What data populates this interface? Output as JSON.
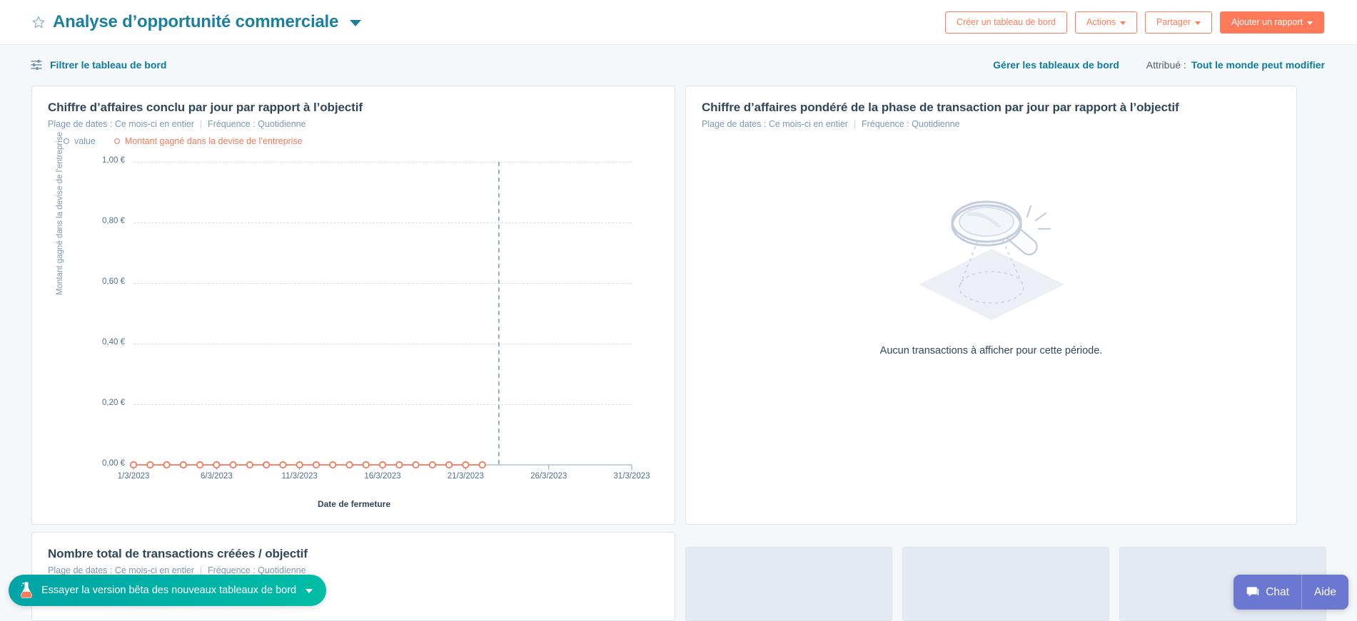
{
  "header": {
    "star_icon": "star-outline-icon",
    "title": "Analyse d’opportunité commerciale",
    "title_caret": "chevron-down-icon",
    "buttons": {
      "create_dashboard": "Créer un tableau de bord",
      "actions": "Actions",
      "share": "Partager",
      "add_report": "Ajouter un rapport"
    },
    "colors": {
      "accent_orange": "#ff7a59",
      "title_teal": "#1b7fa0"
    }
  },
  "filterbar": {
    "filter_icon": "sliders-icon",
    "filter_label": "Filtrer le tableau de bord",
    "manage_label": "Gérer les tableaux de bord",
    "assigned_label": "Attribué :",
    "assigned_value": "Tout le monde peut modifier"
  },
  "cards": {
    "revenue": {
      "title": "Chiffre d’affaires conclu par jour par rapport à l’objectif",
      "date_range": "Plage de dates : Ce mois-ci en entier",
      "frequency": "Fréquence : Quotidienne",
      "legend": [
        {
          "label": "value",
          "color": "#7c98b6"
        },
        {
          "label": "Montant gagné dans la devise de l’entreprise",
          "color": "#f2785c"
        }
      ]
    },
    "weighted": {
      "title": "Chiffre d’affaires pondéré de la phase de transaction par jour par rapport à l’objectif",
      "date_range": "Plage de dates : Ce mois-ci en entier",
      "frequency": "Fréquence : Quotidienne",
      "empty_icon": "magnifier-search-illustration",
      "empty_text": "Aucun transactions à afficher pour cette période."
    },
    "deals": {
      "title": "Nombre total de transactions créées / objectif",
      "date_range": "Plage de dates : Ce mois-ci en entier",
      "frequency": "Fréquence : Quotidienne"
    },
    "skeletons": [
      {
        "name": "skeleton-card-1"
      },
      {
        "name": "skeleton-card-2"
      },
      {
        "name": "skeleton-card-3"
      }
    ]
  },
  "chart_data": {
    "type": "line",
    "title": "Chiffre d’affaires conclu par jour par rapport à l’objectif",
    "xlabel": "Date de fermeture",
    "ylabel": "Montant gagné dans la devise de l’entreprise",
    "ylim": [
      0,
      1
    ],
    "ytick_labels": [
      "0,00 €",
      "0,20 €",
      "0,40 €",
      "0,60 €",
      "0,80 €",
      "1,00 €"
    ],
    "ytick_values": [
      0,
      0.2,
      0.4,
      0.6,
      0.8,
      1.0
    ],
    "xtick_labels": [
      "1/3/2023",
      "6/3/2023",
      "11/3/2023",
      "16/3/2023",
      "21/3/2023",
      "26/3/2023",
      "31/3/2023"
    ],
    "xtick_values": [
      1,
      6,
      11,
      16,
      21,
      26,
      31
    ],
    "xlim": [
      1,
      31
    ],
    "grid": true,
    "legend_position": "top-left",
    "today_marker_x": 23,
    "series": [
      {
        "name": "Montant gagné dans la devise de l’entreprise",
        "color": "#f2785c",
        "x": [
          1,
          2,
          3,
          4,
          5,
          6,
          7,
          8,
          9,
          10,
          11,
          12,
          13,
          14,
          15,
          16,
          17,
          18,
          19,
          20,
          21,
          22
        ],
        "values": [
          0,
          0,
          0,
          0,
          0,
          0,
          0,
          0,
          0,
          0,
          0,
          0,
          0,
          0,
          0,
          0,
          0,
          0,
          0,
          0,
          0,
          0
        ]
      },
      {
        "name": "value",
        "color": "#7c98b6",
        "x": [],
        "values": []
      }
    ]
  },
  "beta_pill": {
    "icon": "flask-icon",
    "label": "Essayer la version bêta des nouveaux tableaux de bord",
    "caret": "chevron-down-icon",
    "color": "#00bda5"
  },
  "chat_widget": {
    "icon": "chat-bubble-icon",
    "chat_label": "Chat",
    "help_label": "Aide",
    "color": "#6a78d1"
  }
}
